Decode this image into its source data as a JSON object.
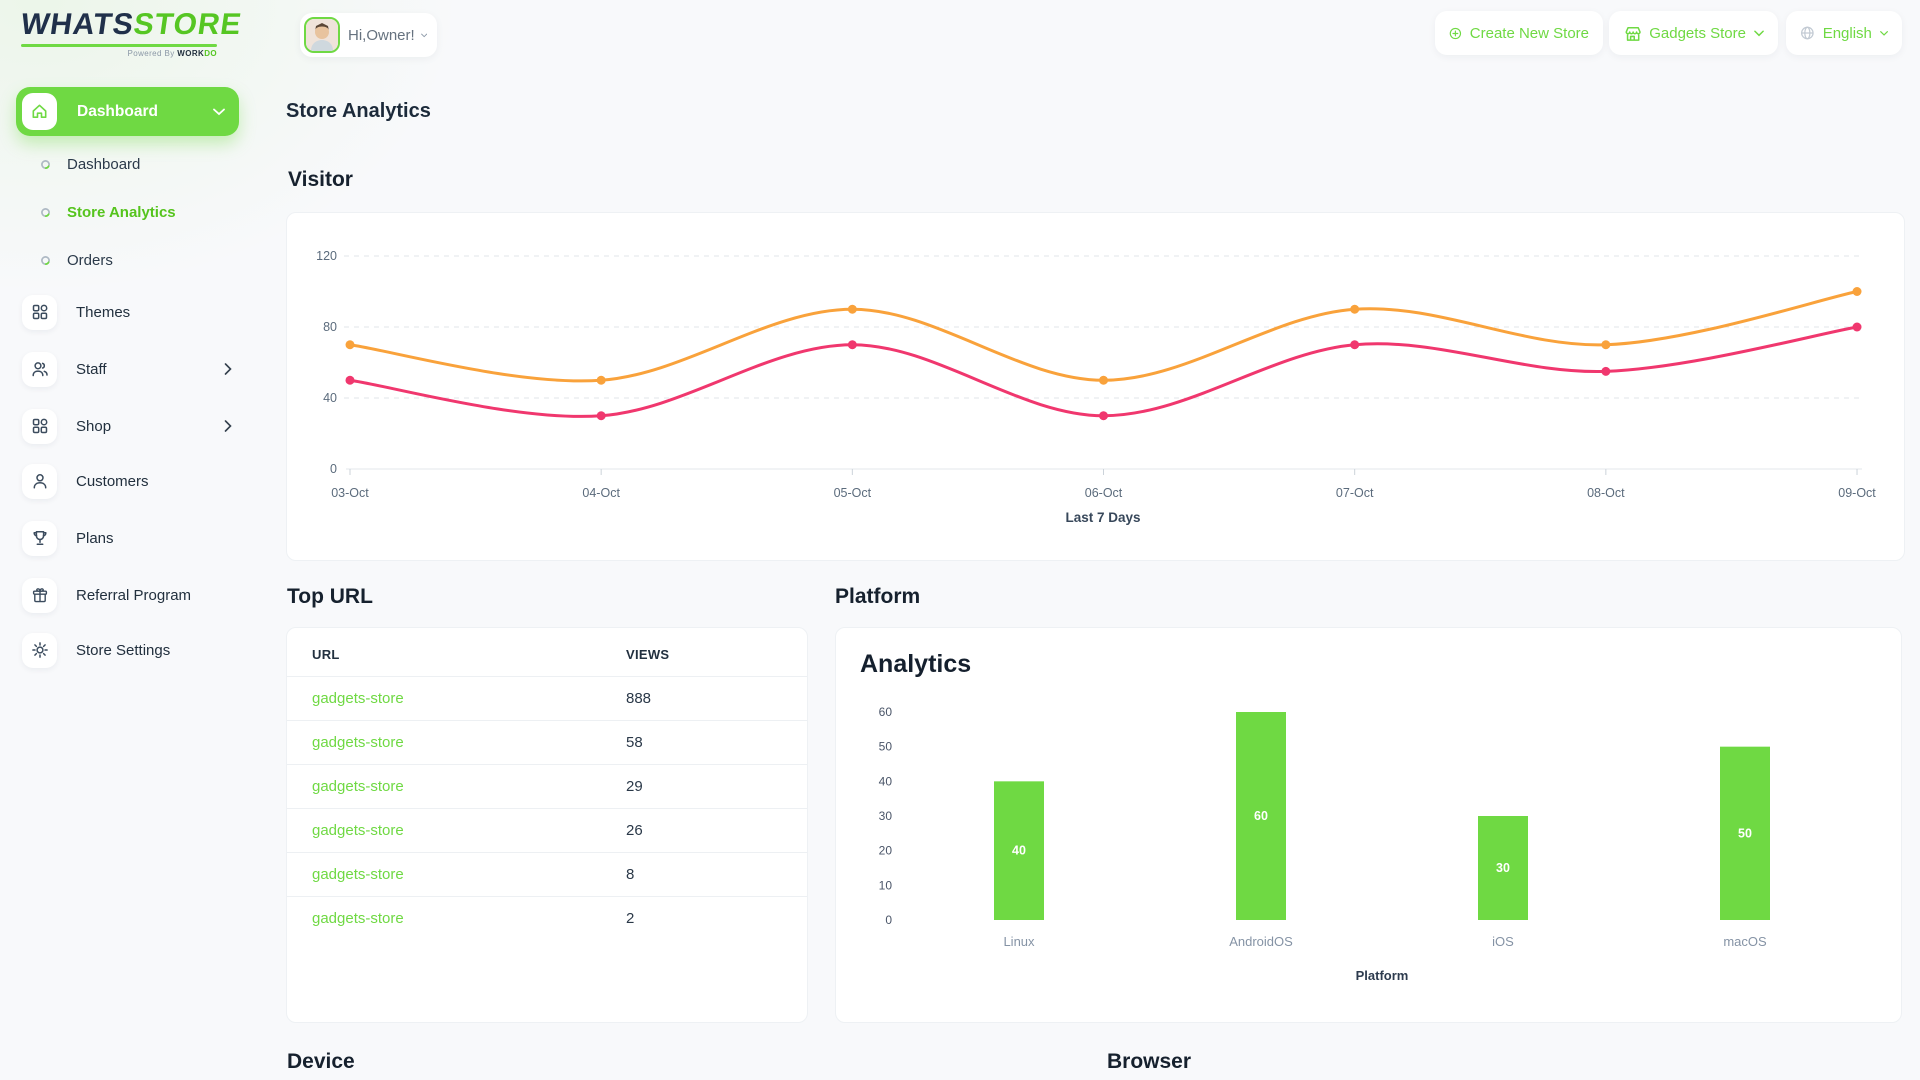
{
  "brand": {
    "name_dark": "WHATS",
    "name_green": "STORE",
    "powered_by": "Powered By ",
    "powered_dark": "WORK",
    "powered_green": "DO"
  },
  "header": {
    "greeting": "Hi,Owner!",
    "create_store": "Create New Store",
    "store_name": "Gadgets Store",
    "language": "English"
  },
  "sidebar": {
    "main_item": "Dashboard",
    "sub_items": [
      {
        "label": "Dashboard",
        "active": false
      },
      {
        "label": "Store Analytics",
        "active": true
      },
      {
        "label": "Orders",
        "active": false
      }
    ],
    "items": [
      {
        "label": "Themes"
      },
      {
        "label": "Staff"
      },
      {
        "label": "Shop"
      },
      {
        "label": "Customers"
      },
      {
        "label": "Plans"
      },
      {
        "label": "Referral Program"
      },
      {
        "label": "Store Settings"
      }
    ]
  },
  "page": {
    "title": "Store Analytics",
    "visitor_heading": "Visitor",
    "top_url_heading": "Top URL",
    "platform_heading": "Platform",
    "device_heading": "Device",
    "browser_heading": "Browser"
  },
  "top_url_table": {
    "columns": [
      "URL",
      "VIEWS"
    ],
    "rows": [
      {
        "url": "gadgets-store",
        "views": "888"
      },
      {
        "url": "gadgets-store",
        "views": "58"
      },
      {
        "url": "gadgets-store",
        "views": "29"
      },
      {
        "url": "gadgets-store",
        "views": "26"
      },
      {
        "url": "gadgets-store",
        "views": "8"
      },
      {
        "url": "gadgets-store",
        "views": "2"
      }
    ]
  },
  "chart_data": [
    {
      "type": "line",
      "title": "Visitor",
      "x": [
        "03-Oct",
        "04-Oct",
        "05-Oct",
        "06-Oct",
        "07-Oct",
        "08-Oct",
        "09-Oct"
      ],
      "xlabel": "Last 7 Days",
      "yticks": [
        0,
        40,
        80,
        120
      ],
      "ylim": [
        0,
        130
      ],
      "grid": "horizontal-dashed",
      "legend": "none",
      "series": [
        {
          "name": "series-orange",
          "color": "#F9A23B",
          "values": [
            70,
            50,
            90,
            50,
            90,
            70,
            100
          ]
        },
        {
          "name": "series-pink",
          "color": "#F0376E",
          "values": [
            50,
            30,
            70,
            30,
            70,
            55,
            80
          ]
        }
      ]
    },
    {
      "type": "bar",
      "title": "Analytics",
      "categories": [
        "Linux",
        "AndroidOS",
        "iOS",
        "macOS"
      ],
      "values": [
        40,
        60,
        30,
        50
      ],
      "xlabel": "Platform",
      "yticks": [
        0,
        10,
        20,
        30,
        40,
        50,
        60
      ],
      "ylim": [
        0,
        60
      ],
      "grid": "off",
      "bar_color": "#6FD943",
      "value_label_color": "#FFFFFF"
    }
  ],
  "colors": {
    "accent_green": "#6FD943",
    "active_text_green": "#55C41D",
    "dark_text": "#192434",
    "gray_text": "#5D6C7B",
    "page_bg": "#F8F9FB",
    "card_bg": "#FFFFFF",
    "line_orange": "#F9A23B",
    "line_pink": "#F0376E"
  }
}
